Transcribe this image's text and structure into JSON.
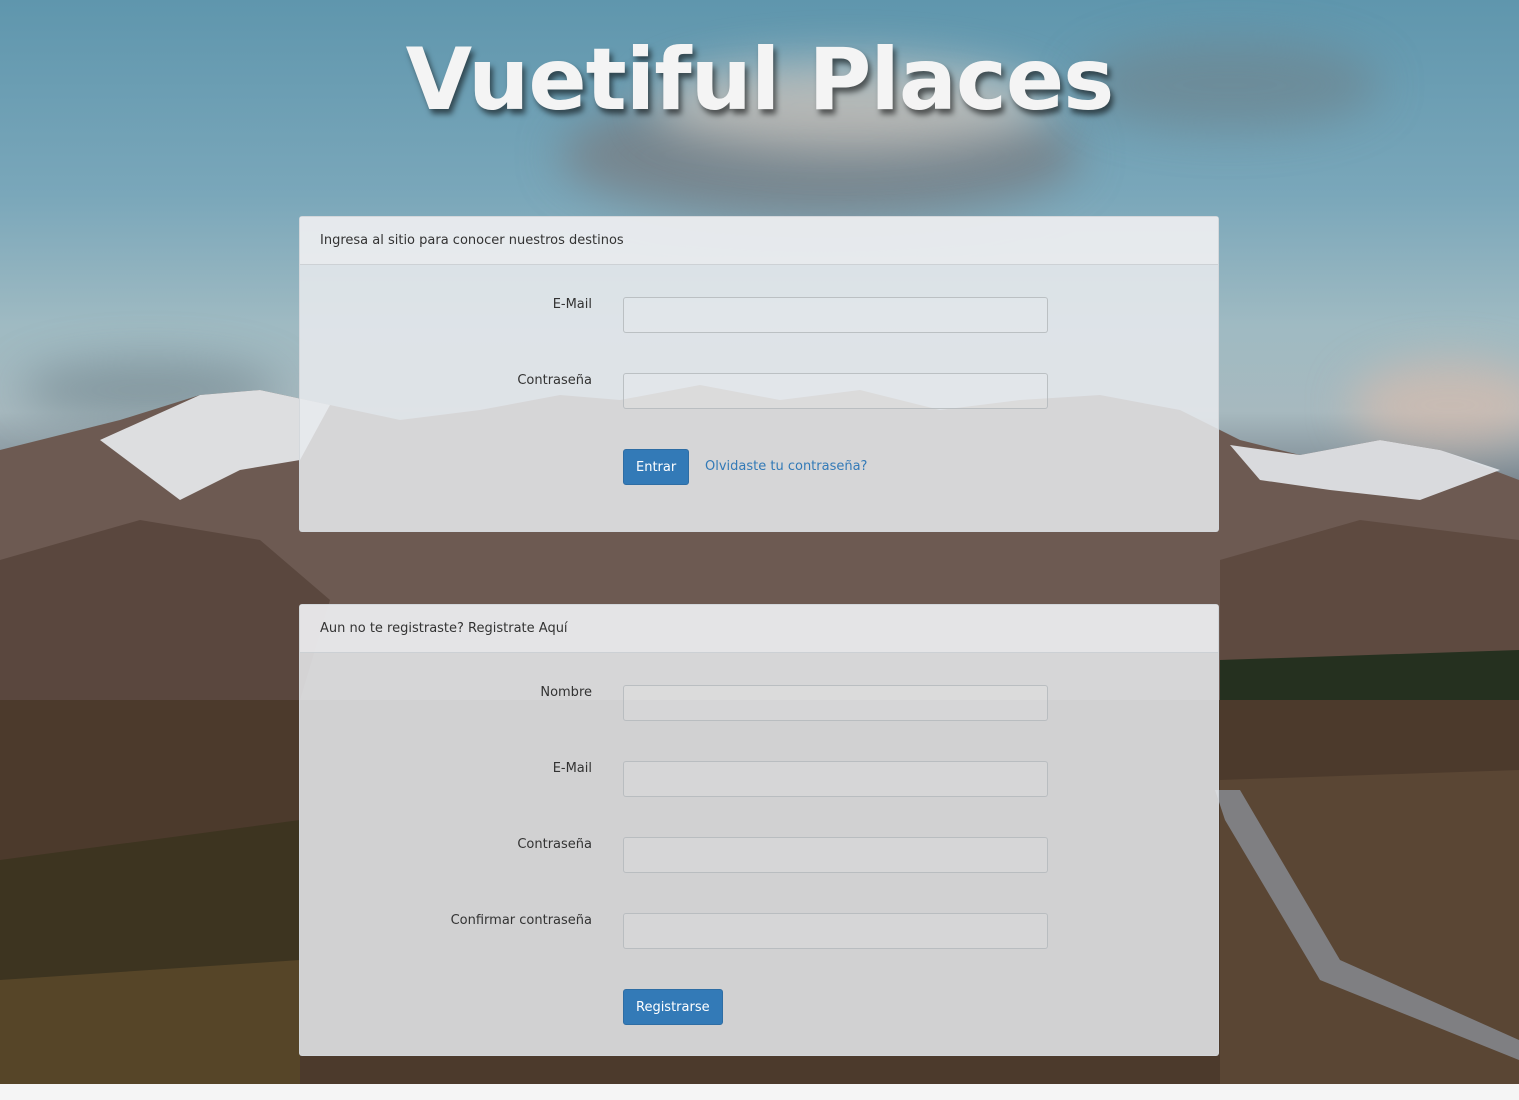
{
  "app": {
    "title": "Vuetiful Places"
  },
  "login": {
    "heading": "Ingresa al sitio para conocer nuestros destinos",
    "email_label": "E-Mail",
    "email_value": "",
    "password_label": "Contraseña",
    "password_value": "",
    "submit_label": "Entrar",
    "forgot_link": "Olvidaste tu contraseña?"
  },
  "register": {
    "heading": "Aun no te registraste? Registrate Aquí",
    "name_label": "Nombre",
    "name_value": "",
    "email_label": "E-Mail",
    "email_value": "",
    "password_label": "Contraseña",
    "password_value": "",
    "confirm_label": "Confirmar contraseña",
    "confirm_value": "",
    "submit_label": "Registrarse"
  },
  "colors": {
    "primary": "#337ab7",
    "panel_bg": "#e8eaed",
    "title_text": "#f4f4f4"
  }
}
